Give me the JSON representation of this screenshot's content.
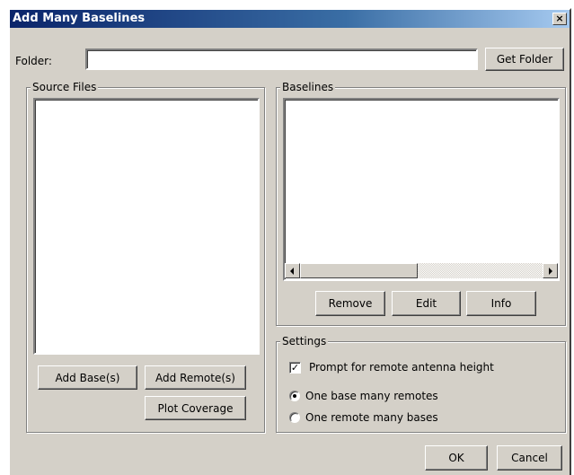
{
  "window": {
    "title": "Add Many Baselines",
    "close_glyph": "×"
  },
  "folder": {
    "label": "Folder:",
    "value": "",
    "get_folder_label": "Get Folder"
  },
  "source_files": {
    "group_title": "Source Files",
    "add_base_label": "Add Base(s)",
    "add_remote_label": "Add Remote(s)",
    "plot_coverage_label": "Plot Coverage"
  },
  "baselines": {
    "group_title": "Baselines",
    "remove_label": "Remove",
    "edit_label": "Edit",
    "info_label": "Info"
  },
  "settings": {
    "group_title": "Settings",
    "prompt_label": "Prompt for remote antenna height",
    "prompt_checked": true,
    "option_one_base": "One base many remotes",
    "option_one_remote": "One remote many bases",
    "selected_option": "One base many remotes"
  },
  "footer": {
    "ok_label": "OK",
    "cancel_label": "Cancel"
  }
}
